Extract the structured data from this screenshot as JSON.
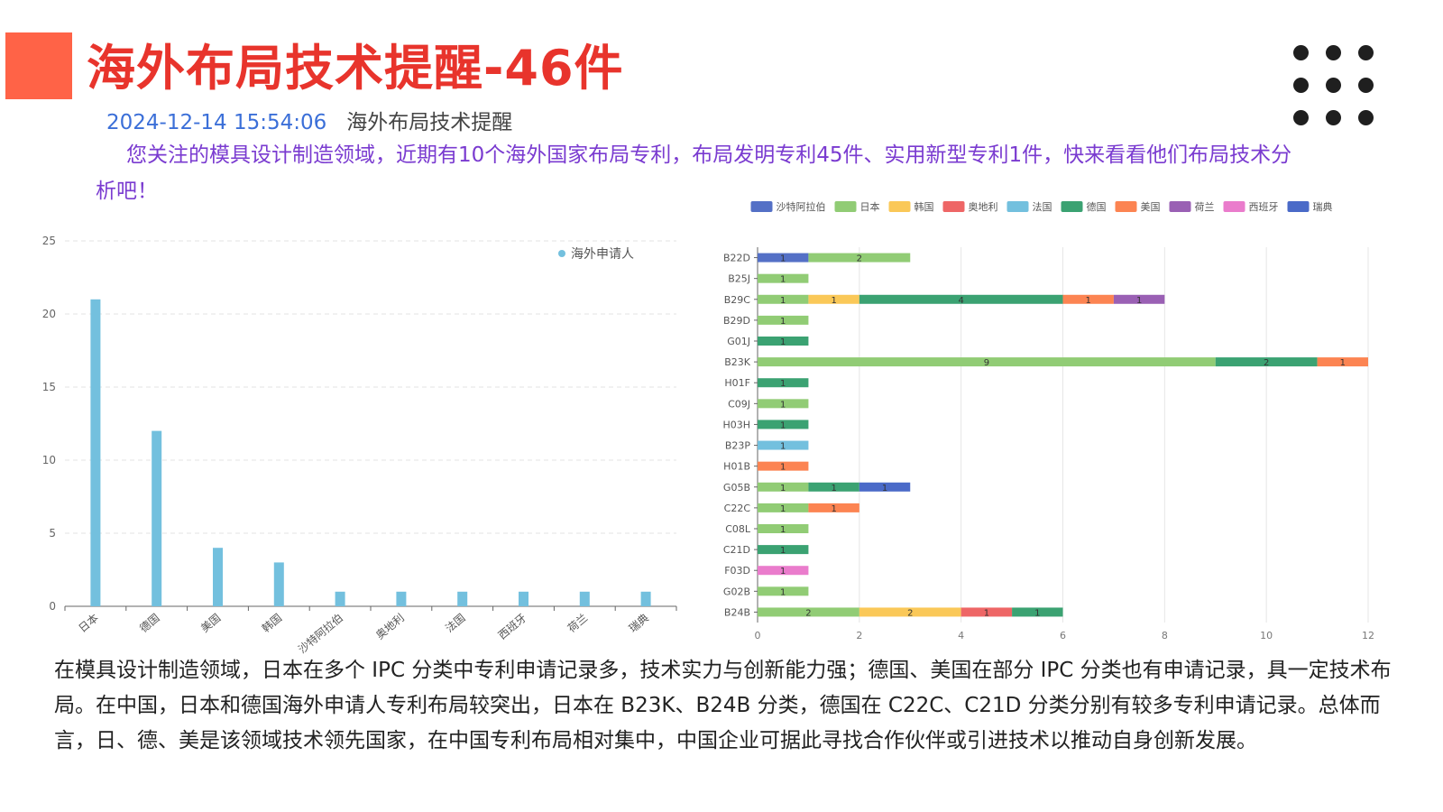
{
  "header": {
    "title": "海外布局技术提醒-46件",
    "timestamp": "2024-12-14 15:54:06",
    "category": "海外布局技术提醒",
    "intro": "您关注的模具设计制造领域，近期有10个海外国家布局专利，布局发明专利45件、实用新型专利1件，快来看看他们布局技术分析吧！"
  },
  "colors": {
    "accent": "#ff6347",
    "title": "#e8342c",
    "timestamp": "#3b6fd8",
    "intro": "#7a3bd0",
    "bar": "#73c0de"
  },
  "icons": {
    "menu": "grid-dots-icon"
  },
  "summary": "在模具设计制造领域，日本在多个 IPC 分类中专利申请记录多，技术实力与创新能力强；德国、美国在部分 IPC 分类也有申请记录，具一定技术布局。在中国，日本和德国海外申请人专利布局较突出，日本在 B23K、B24B 分类，德国在 C22C、C21D 分类分别有较多专利申请记录。总体而言，日、德、美是该领域技术领先国家，在中国专利布局相对集中，中国企业可据此寻找合作伙伴或引进技术以推动自身创新发展。",
  "chart_data": [
    {
      "type": "bar",
      "legend": [
        "海外申请人"
      ],
      "legend_position": "top-right",
      "categories": [
        "日本",
        "德国",
        "美国",
        "韩国",
        "沙特阿拉伯",
        "奥地利",
        "法国",
        "西班牙",
        "荷兰",
        "瑞典"
      ],
      "series": [
        {
          "name": "海外申请人",
          "values": [
            21,
            12,
            4,
            3,
            1,
            1,
            1,
            1,
            1,
            1
          ]
        }
      ],
      "ylim": [
        0,
        25
      ],
      "yticks": [
        0,
        5,
        10,
        15,
        20,
        25
      ],
      "grid": true
    },
    {
      "type": "bar",
      "orientation": "horizontal",
      "stacked": true,
      "legend_position": "top",
      "categories": [
        "B22D",
        "B25J",
        "B29C",
        "B29D",
        "G01J",
        "B23K",
        "H01F",
        "C09J",
        "H03H",
        "B23P",
        "H01B",
        "G05B",
        "C22C",
        "C08L",
        "C21D",
        "F03D",
        "G02B",
        "B24B"
      ],
      "xlim": [
        0,
        12
      ],
      "xticks": [
        0,
        2,
        4,
        6,
        8,
        10,
        12
      ],
      "grid": true,
      "series": [
        {
          "name": "沙特阿拉伯",
          "color": "#5470c6",
          "values": [
            1,
            0,
            0,
            0,
            0,
            0,
            0,
            0,
            0,
            0,
            0,
            0,
            0,
            0,
            0,
            0,
            0,
            0
          ]
        },
        {
          "name": "日本",
          "color": "#91cc75",
          "values": [
            2,
            1,
            1,
            1,
            0,
            9,
            0,
            1,
            0,
            0,
            0,
            1,
            1,
            1,
            0,
            0,
            1,
            2
          ]
        },
        {
          "name": "韩国",
          "color": "#fac858",
          "values": [
            0,
            0,
            1,
            0,
            0,
            0,
            0,
            0,
            0,
            0,
            0,
            0,
            0,
            0,
            0,
            0,
            0,
            2
          ]
        },
        {
          "name": "奥地利",
          "color": "#ee6666",
          "values": [
            0,
            0,
            0,
            0,
            0,
            0,
            0,
            0,
            0,
            0,
            0,
            0,
            0,
            0,
            0,
            0,
            0,
            1
          ]
        },
        {
          "name": "法国",
          "color": "#73c0de",
          "values": [
            0,
            0,
            0,
            0,
            0,
            0,
            0,
            0,
            0,
            1,
            0,
            0,
            0,
            0,
            0,
            0,
            0,
            0
          ]
        },
        {
          "name": "德国",
          "color": "#3ba272",
          "values": [
            0,
            0,
            4,
            0,
            1,
            2,
            1,
            0,
            1,
            0,
            0,
            1,
            0,
            0,
            1,
            0,
            0,
            1
          ]
        },
        {
          "name": "美国",
          "color": "#fc8452",
          "values": [
            0,
            0,
            1,
            0,
            0,
            1,
            0,
            0,
            0,
            0,
            1,
            0,
            1,
            0,
            0,
            0,
            0,
            0
          ]
        },
        {
          "name": "荷兰",
          "color": "#9a60b4",
          "values": [
            0,
            0,
            1,
            0,
            0,
            0,
            0,
            0,
            0,
            0,
            0,
            0,
            0,
            0,
            0,
            0,
            0,
            0
          ]
        },
        {
          "name": "西班牙",
          "color": "#ea7ccc",
          "values": [
            0,
            0,
            0,
            0,
            0,
            0,
            0,
            0,
            0,
            0,
            0,
            0,
            0,
            0,
            0,
            1,
            0,
            0
          ]
        },
        {
          "name": "瑞典",
          "color": "#4a6ac8",
          "values": [
            0,
            0,
            0,
            0,
            0,
            0,
            0,
            0,
            0,
            0,
            0,
            1,
            0,
            0,
            0,
            0,
            0,
            0
          ]
        }
      ]
    }
  ]
}
